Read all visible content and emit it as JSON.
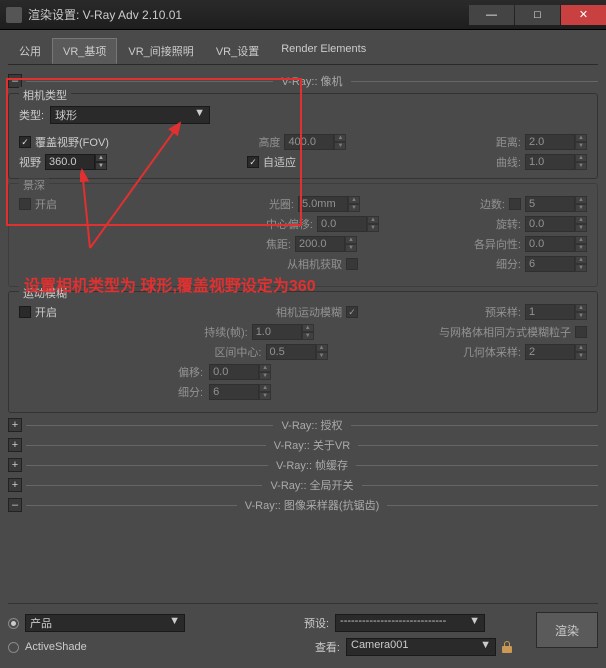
{
  "titlebar": {
    "text": "渲染设置: V-Ray Adv 2.10.01"
  },
  "tabs": {
    "t0": "公用",
    "t1": "VR_基项",
    "t2": "VR_间接照明",
    "t3": "VR_设置",
    "t4": "Render Elements"
  },
  "sec_camera": "V-Ray:: 像机",
  "camera": {
    "group_title": "相机类型",
    "type_lbl": "类型:",
    "type_val": "球形",
    "fov_cover": "覆盖视野(FOV)",
    "height_lbl": "高度",
    "height_val": "400.0",
    "dist_lbl": "距离:",
    "dist_val": "2.0",
    "fov_lbl": "视野",
    "fov_val": "360.0",
    "auto_lbl": "自适应",
    "curve_lbl": "曲线:",
    "curve_val": "1.0"
  },
  "dof": {
    "group_title": "景深",
    "enable": "开启",
    "aperture_lbl": "光圈:",
    "aperture_val": "5.0mm",
    "sides_lbl": "边数:",
    "sides_val": "5",
    "center_lbl": "中心偏移:",
    "center_val": "0.0",
    "rot_lbl": "旋转:",
    "rot_val": "0.0",
    "focal_lbl": "焦距:",
    "focal_val": "200.0",
    "aniso_lbl": "各异向性:",
    "aniso_val": "0.0",
    "from_cam": "从相机获取",
    "subdiv_lbl": "细分:",
    "subdiv_val": "6"
  },
  "annotation": "设置相机类型为 球形,覆盖视野设定为360",
  "mblur": {
    "group_title": "运动模糊",
    "enable": "开启",
    "cam_blur": "相机运动模糊",
    "presample_lbl": "预采样:",
    "presample_val": "1",
    "duration_lbl": "持续(帧):",
    "duration_val": "1.0",
    "mesh_particle": "与网格体相同方式模糊粒子",
    "interval_lbl": "区间中心:",
    "interval_val": "0.5",
    "geom_sample_lbl": "几何体采样:",
    "geom_sample_val": "2",
    "bias_lbl": "偏移:",
    "bias_val": "0.0",
    "subdiv_lbl": "细分:",
    "subdiv_val": "6"
  },
  "rollouts": {
    "r0": "V-Ray:: 授权",
    "r1": "V-Ray:: 关于VR",
    "r2": "V-Ray:: 帧缓存",
    "r3": "V-Ray:: 全局开关",
    "r4": "V-Ray:: 图像采样器(抗锯齿)"
  },
  "bottom": {
    "product": "产品",
    "preset_lbl": "预设:",
    "preset_val": "-----------------------------",
    "activeshade": "ActiveShade",
    "view_lbl": "查看:",
    "view_val": "Camera001",
    "render_btn": "渲染"
  }
}
